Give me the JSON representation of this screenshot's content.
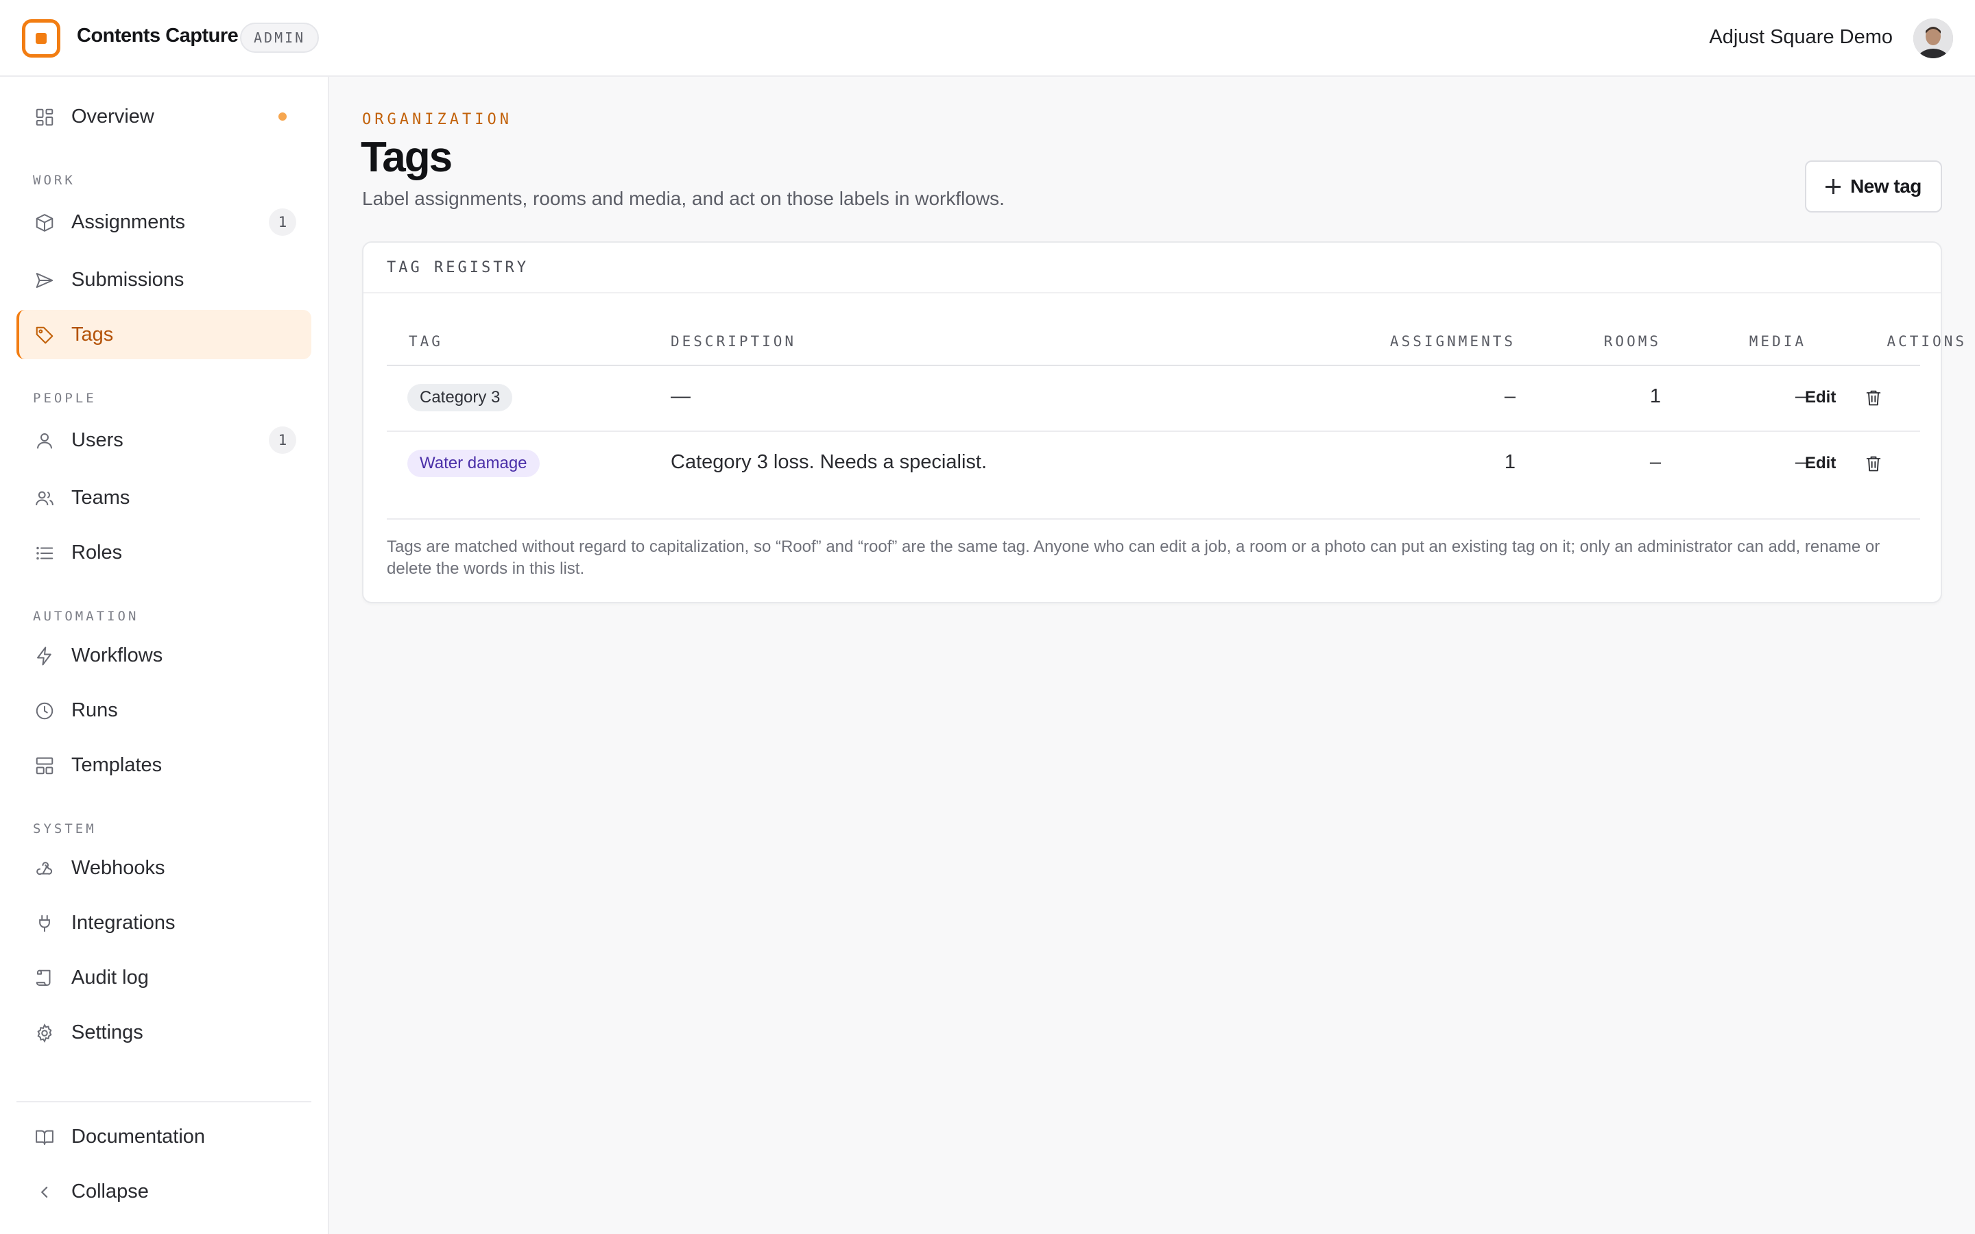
{
  "app": {
    "name": "Contents Capture",
    "badge": "ADMIN",
    "account_name": "Adjust Square Demo"
  },
  "sidebar": {
    "overview": {
      "label": "Overview"
    },
    "sections": {
      "work": "WORK",
      "people": "PEOPLE",
      "automation": "AUTOMATION",
      "system": "SYSTEM"
    },
    "items": {
      "assignments": {
        "label": "Assignments",
        "count": "1"
      },
      "submissions": {
        "label": "Submissions"
      },
      "tags": {
        "label": "Tags"
      },
      "users": {
        "label": "Users",
        "count": "1"
      },
      "teams": {
        "label": "Teams"
      },
      "roles": {
        "label": "Roles"
      },
      "workflows": {
        "label": "Workflows"
      },
      "runs": {
        "label": "Runs"
      },
      "templates": {
        "label": "Templates"
      },
      "webhooks": {
        "label": "Webhooks"
      },
      "integrations": {
        "label": "Integrations"
      },
      "audit_log": {
        "label": "Audit log"
      },
      "settings": {
        "label": "Settings"
      },
      "documentation": {
        "label": "Documentation"
      },
      "collapse": {
        "label": "Collapse"
      }
    },
    "active_item": "tags",
    "accent_color": "#f27d12"
  },
  "page": {
    "eyebrow": "ORGANIZATION",
    "title": "Tags",
    "subtitle": "Label assignments, rooms and media, and act on those labels in workflows.",
    "new_button": "New tag"
  },
  "registry": {
    "title": "TAG REGISTRY",
    "columns": {
      "tag": "TAG",
      "description": "DESCRIPTION",
      "assignments": "ASSIGNMENTS",
      "rooms": "ROOMS",
      "media": "MEDIA",
      "actions": "ACTIONS"
    },
    "rows": [
      {
        "tag": "Category 3",
        "tag_color": "gray",
        "description": "—",
        "assignments": "–",
        "rooms": "1",
        "media": "–",
        "edit": "Edit"
      },
      {
        "tag": "Water damage",
        "tag_color": "purple",
        "description": "Category 3 loss. Needs a specialist.",
        "assignments": "1",
        "rooms": "–",
        "media": "–",
        "edit": "Edit"
      }
    ],
    "footnote": "Tags are matched without regard to capitalization, so “Roof” and “roof” are the same tag. Anyone who can edit a job, a room or a photo can put an existing tag on it; only an administrator can add, rename or delete the words in this list."
  }
}
